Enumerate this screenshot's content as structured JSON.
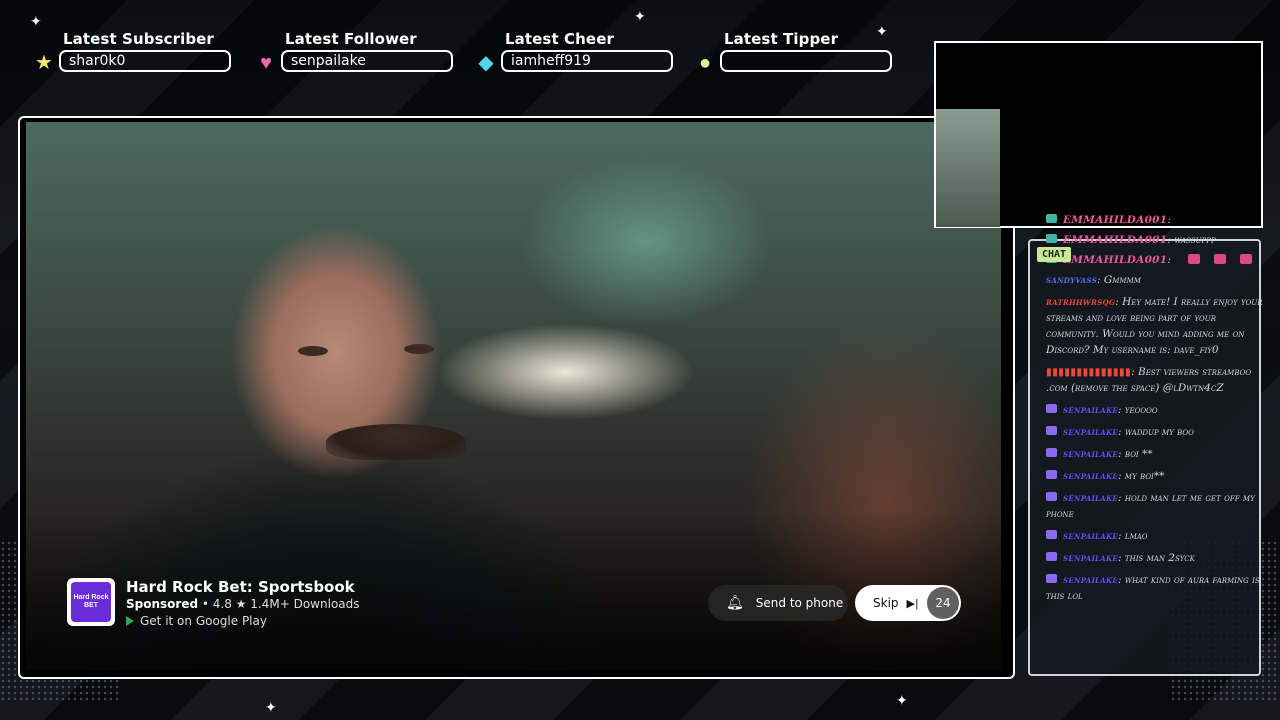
{
  "stats": [
    {
      "label": "Latest Subscriber",
      "value": "shar0k0",
      "icon": "star-icon",
      "color": "#f2e86a"
    },
    {
      "label": "Latest Follower",
      "value": "senpailake",
      "icon": "heart-icon",
      "color": "#e86ab4"
    },
    {
      "label": "Latest Cheer",
      "value": "iamheff919",
      "icon": "diamond-icon",
      "color": "#4fd6e8"
    },
    {
      "label": "Latest Tipper",
      "value": "",
      "icon": "coin-icon",
      "color": "#d9f09a"
    }
  ],
  "ad": {
    "logo_text": "Hard Rock BET",
    "title": "Hard Rock Bet: Sportsbook",
    "sponsored": "Sponsored",
    "rating": "4.8",
    "downloads": "1.4M+ Downloads",
    "store": "Get it on Google Play",
    "send_to_phone": "Send to phone",
    "skip": "Skip",
    "countdown": "24"
  },
  "chat": {
    "badge": "CHAT",
    "messages": [
      {
        "user": "EMMAHILDA001",
        "text": "",
        "color": "#e85a9b",
        "icon_color": "#3fb5a5"
      },
      {
        "user": "EMMAHILDA001",
        "text": "wassuppp",
        "color": "#e85a9b",
        "icon_color": "#3fb5a5"
      },
      {
        "user": "EMMAHILDA001",
        "text": "",
        "color": "#e85a9b",
        "icon_color": "#3fb5a5",
        "emotes": 3
      },
      {
        "user": "sandyvass",
        "text": "Gmmmm",
        "color": "#5a6cf0",
        "icon_color": ""
      },
      {
        "user": "ratrhhwrsqg",
        "text": "Hey mate! I really enjoy your streams and love being part of your community. Would you mind adding me on Discord? My username is: dave_fiy0",
        "color": "#e84a3a",
        "icon_color": ""
      },
      {
        "user": "",
        "text": "Best viewers streamboo .com (remove the space) @lDwtn4cZ",
        "color": "#e84a3a",
        "icon_color": ""
      },
      {
        "user": "senpailake",
        "text": "yeoooo",
        "color": "#6a4ef0",
        "icon_color": "#8a6af0"
      },
      {
        "user": "senpailake",
        "text": "waddup my boo",
        "color": "#6a4ef0",
        "icon_color": "#8a6af0"
      },
      {
        "user": "senpailake",
        "text": "boi **",
        "color": "#6a4ef0",
        "icon_color": "#8a6af0"
      },
      {
        "user": "senpailake",
        "text": "my boi**",
        "color": "#6a4ef0",
        "icon_color": "#8a6af0"
      },
      {
        "user": "senpailake",
        "text": "hold man let me get off my phone",
        "color": "#6a4ef0",
        "icon_color": "#8a6af0"
      },
      {
        "user": "senpailake",
        "text": "lmao",
        "color": "#6a4ef0",
        "icon_color": "#8a6af0"
      },
      {
        "user": "senpailake",
        "text": "this man 2syck",
        "color": "#6a4ef0",
        "icon_color": "#8a6af0"
      },
      {
        "user": "senpailake",
        "text": "what kind of aura farming is this lol",
        "color": "#6a4ef0",
        "icon_color": "#8a6af0"
      }
    ]
  }
}
